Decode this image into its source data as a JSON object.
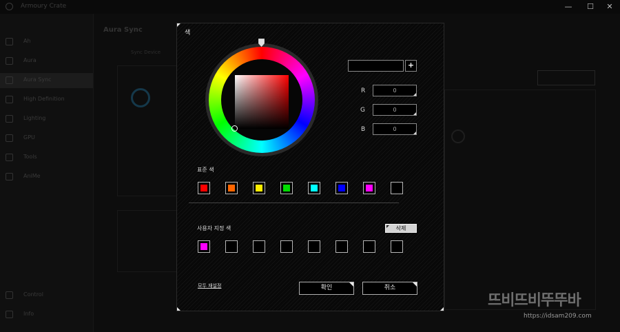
{
  "app": {
    "window_title": "Armoury Crate"
  },
  "window_controls": {
    "minimize": "—",
    "maximize": "☐",
    "close": "✕"
  },
  "sidebar": {
    "items": [
      {
        "label": "Ah"
      },
      {
        "label": "Aura"
      },
      {
        "label": "Aura Sync"
      },
      {
        "label": "High Definition"
      },
      {
        "label": "Lighting"
      },
      {
        "label": "GPU"
      },
      {
        "label": "Tools"
      },
      {
        "label": "AniMe"
      },
      {
        "label": "Control"
      },
      {
        "label": "Info"
      }
    ]
  },
  "main": {
    "title": "Aura Sync",
    "tab": "Sync Device"
  },
  "dialog": {
    "title": "색",
    "hex_value": "",
    "add_label": "+",
    "rgb": {
      "r_label": "R",
      "g_label": "G",
      "b_label": "B",
      "r": "0",
      "g": "0",
      "b": "0"
    },
    "standard_label": "표준 색",
    "standard_colors": [
      "#ff0000",
      "#ff6600",
      "#ffee00",
      "#00dd00",
      "#00ffff",
      "#0000ff",
      "#ff00ff",
      "#000000"
    ],
    "custom_label": "사용자 지정 색",
    "delete_label": "삭제",
    "custom_colors": [
      "#ff00ff",
      "",
      "",
      "",
      "",
      "",
      "",
      ""
    ],
    "reset_label": "모두 재설정",
    "ok_label": "확인",
    "cancel_label": "취소"
  },
  "watermark": {
    "logo": "뜨비뜨비뚜뚜바",
    "url": "https://idsam209.com"
  }
}
